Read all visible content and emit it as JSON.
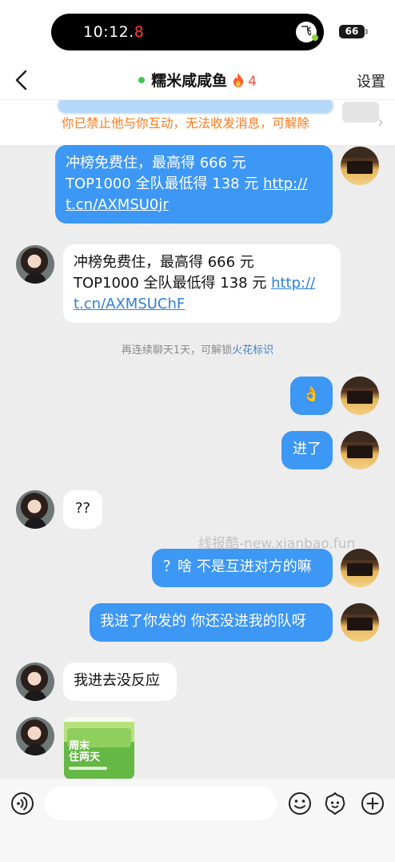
{
  "status": {
    "time_main": "10:12.",
    "time_red": "8",
    "app_badge": "飞",
    "battery": "66"
  },
  "header": {
    "title": "糯米咸咸鱼",
    "streak_count": "4",
    "settings_label": "设置"
  },
  "banner": {
    "text": "你已禁止他与你互动，无法收发消息，可解除"
  },
  "messages": [
    {
      "side": "out",
      "line1": "冲榜免费住，最高得 666 元",
      "line2_text": "TOP1000 全队最低得 138 元 ",
      "link_part1": "http://",
      "link_part2": "t.cn/AXMSU0jr"
    },
    {
      "side": "in",
      "line1": "冲榜免费住，最高得 666 元",
      "line2_text": "TOP1000 全队最低得 138 元 ",
      "link_part1": "http://",
      "link_part2": "t.cn/AXMSUChF"
    },
    {
      "side": "out",
      "text": "👌"
    },
    {
      "side": "out",
      "text": "进了"
    },
    {
      "side": "in",
      "text": "??"
    },
    {
      "side": "out",
      "text": "？啥 不是互进对方的嘛"
    },
    {
      "side": "out",
      "text": "我进了你发的 你还没进我的队呀"
    },
    {
      "side": "in",
      "text": "我进去没反应"
    }
  ],
  "notice": {
    "prefix": "再连续聊天1天，可解锁",
    "highlight": "火花标识"
  },
  "watermark": "线报酷-new.xianbao.fun",
  "shared_image": {
    "title_line1": "周末",
    "title_line2": "住两天"
  },
  "colors": {
    "outgoing_bubble": "#3d97f5",
    "incoming_bubble": "#ffffff",
    "banner_text": "#ff7a1a",
    "background": "#ededed"
  }
}
